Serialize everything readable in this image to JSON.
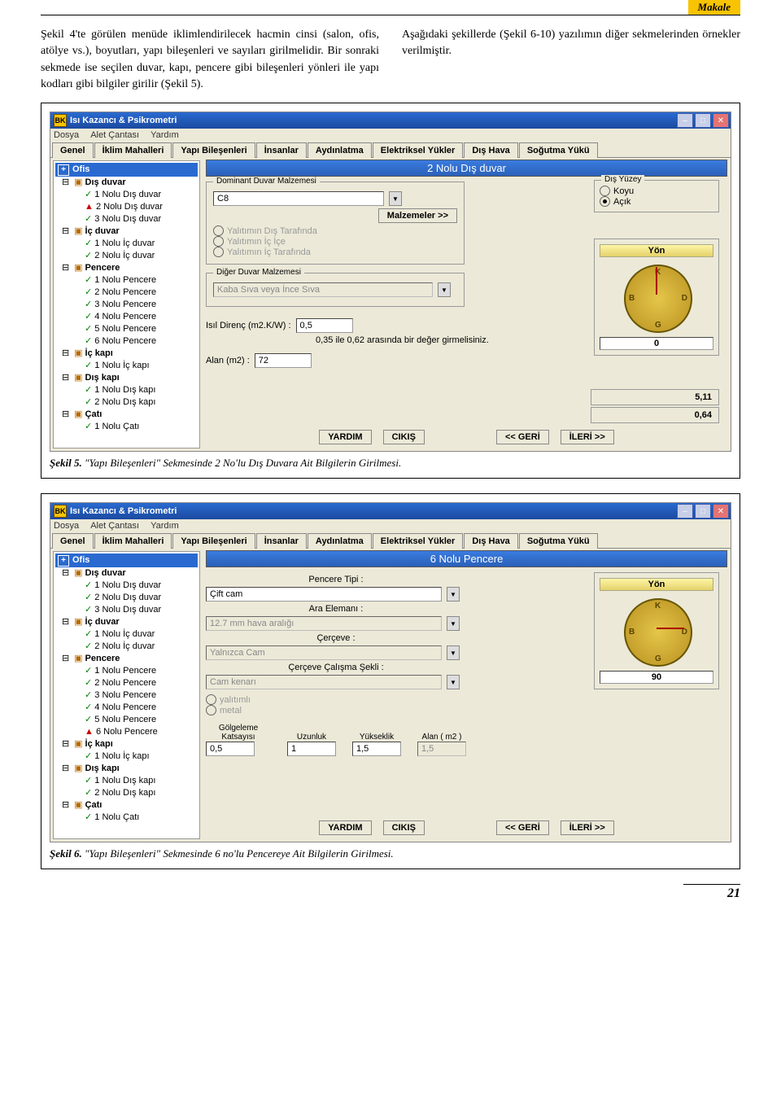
{
  "header": {
    "chip": "Makale"
  },
  "paragraphs": {
    "left": "Şekil 4'te görülen menüde iklimlendirilecek hacmin cinsi (salon, ofis, atölye vs.), boyutları, yapı bileşenleri ve sayıları girilmelidir. Bir sonraki sekmede ise seçilen duvar, kapı, pencere gibi bileşenleri yönleri ile yapı kodları gibi bilgiler girilir (Şekil 5).",
    "right": "Aşağıdaki şekillerde (Şekil 6-10) yazılımın diğer sekmelerinden örnekler verilmiştir."
  },
  "app": {
    "title": "Isı Kazancı & Psikrometri",
    "logo": "BK",
    "menus": [
      "Dosya",
      "Alet Çantası",
      "Yardım"
    ],
    "tabs": [
      "Genel",
      "İklim Mahalleri",
      "Yapı Bileşenleri",
      "İnsanlar",
      "Aydınlatma",
      "Elektriksel Yükler",
      "Dış Hava",
      "Soğutma Yükü"
    ],
    "active_tab": "Yapı Bileşenleri",
    "tree_root": "Ofis",
    "buttons": {
      "help": "YARDIM",
      "exit": "CIKIŞ",
      "back": "<<  GERİ",
      "next": "İLERİ  >>"
    }
  },
  "tree": {
    "groups": [
      {
        "label": "Dış duvar",
        "items": [
          "1 Nolu Dış duvar",
          "2 Nolu Dış duvar",
          "3 Nolu Dış duvar"
        ]
      },
      {
        "label": "İç duvar",
        "items": [
          "1 Nolu İç duvar",
          "2 Nolu İç duvar"
        ]
      },
      {
        "label": "Pencere",
        "items": [
          "1 Nolu Pencere",
          "2 Nolu Pencere",
          "3 Nolu Pencere",
          "4 Nolu Pencere",
          "5 Nolu Pencere",
          "6 Nolu Pencere"
        ]
      },
      {
        "label": "İç kapı",
        "items": [
          "1 Nolu İç kapı"
        ]
      },
      {
        "label": "Dış kapı",
        "items": [
          "1 Nolu Dış kapı",
          "2 Nolu Dış kapı"
        ]
      },
      {
        "label": "Çatı",
        "items": [
          "1 Nolu Çatı"
        ]
      }
    ]
  },
  "fig5": {
    "banner": "2 Nolu Dış duvar",
    "dominant_legend": "Dominant Duvar Malzemesi",
    "dominant_value": "C8",
    "materials_btn": "Malzemeler >>",
    "opt1": "Yalıtımın Dış Tarafında",
    "opt2": "Yalıtımın İç İçe",
    "opt3": "Yalıtımın İç Tarafında",
    "other_legend": "Diğer Duvar Malzemesi",
    "other_value": "Kaba Sıva veya İnce Sıva",
    "res_label": "Isıl Direnç (m2.K/W)  :",
    "res_value": "0,5",
    "res_hint": "0,35 ile 0,62 arasında bir değer girmelisiniz.",
    "area_label": "Alan  (m2) :",
    "area_value": "72",
    "surface_legend": "Dış Yüzey",
    "surface_opt1": "Koyu",
    "surface_opt2": "Açık",
    "yon_label": "Yön",
    "yon_value": "0",
    "readout1": "5,11",
    "readout2": "0,64",
    "warn_index": 1,
    "caption": "Şekil 5. \"Yapı Bileşenleri\" Sekmesinde 2 No'lu Dış Duvara Ait Bilgilerin Girilmesi."
  },
  "fig6": {
    "banner": "6 Nolu Pencere",
    "f_type_label": "Pencere Tipi :",
    "f_type_value": "Çift cam",
    "f_ara_label": "Ara Elemanı :",
    "f_ara_value": "12.7 mm hava aralığı",
    "f_cerc_label": "Çerçeve :",
    "f_cerc_value": "Yalnızca Cam",
    "f_work_label": "Çerçeve Çalışma Şekli :",
    "f_work_value": "Cam kenarı",
    "radio1": "yalıtımlı",
    "radio2": "metal",
    "shade_label": "Gölgeleme Katsayısı",
    "shade_value": "0,5",
    "len_label": "Uzunluk",
    "len_value": "1",
    "hgt_label": "Yükseklik",
    "hgt_value": "1,5",
    "area_label": "Alan ( m2 )",
    "area_value": "1,5",
    "yon_label": "Yön",
    "yon_value": "90",
    "warn_index": 5,
    "caption": "Şekil 6. \"Yapı Bileşenleri\" Sekmesinde 6 no'lu Pencereye Ait Bilgilerin Girilmesi."
  },
  "page_number": "21"
}
